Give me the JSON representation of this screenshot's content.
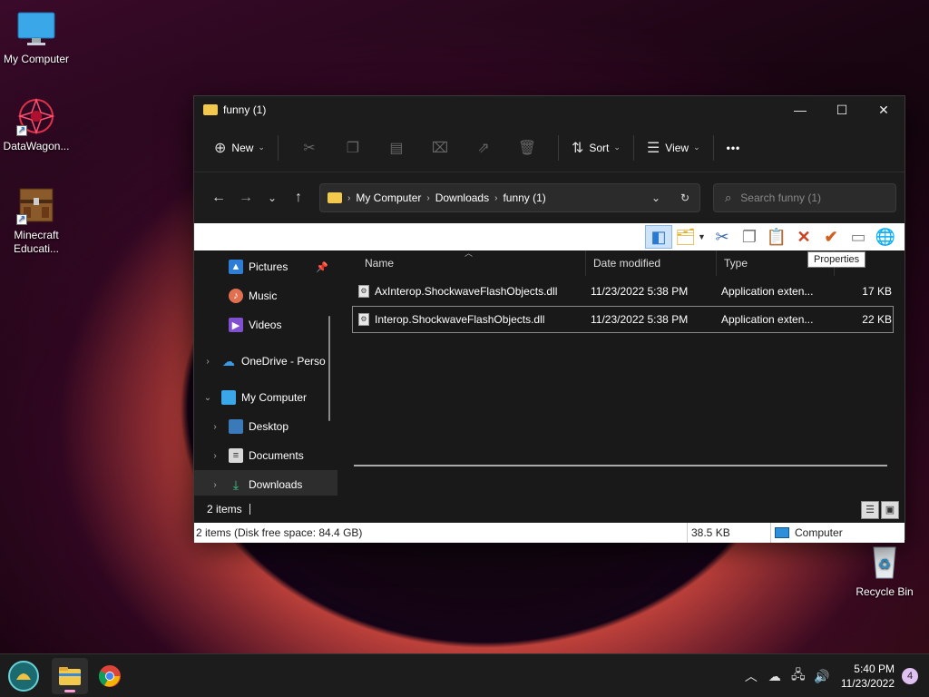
{
  "desktop": {
    "icons": [
      {
        "label": "My Computer"
      },
      {
        "label": "DataWagon..."
      },
      {
        "label": "Minecraft Educati..."
      },
      {
        "label": "Recycle Bin"
      }
    ]
  },
  "window": {
    "title": "funny (1)",
    "controls": {
      "minimize": "—",
      "maximize": "☐",
      "close": "✕"
    }
  },
  "toolbar": {
    "new_label": "New",
    "sort_label": "Sort",
    "view_label": "View",
    "more_label": "•••"
  },
  "address": {
    "crumbs": [
      "My Computer",
      "Downloads",
      "funny (1)"
    ],
    "search_placeholder": "Search funny (1)"
  },
  "legacy_toolbar": {
    "tooltip": "Properties"
  },
  "nav_pane": {
    "items": [
      {
        "label": "Pictures"
      },
      {
        "label": "Music"
      },
      {
        "label": "Videos"
      },
      {
        "label": "OneDrive - Perso"
      },
      {
        "label": "My Computer"
      },
      {
        "label": "Desktop"
      },
      {
        "label": "Documents"
      },
      {
        "label": "Downloads"
      }
    ]
  },
  "file_list": {
    "columns": {
      "name": "Name",
      "date": "Date modified",
      "type": "Type",
      "size": ""
    },
    "files": [
      {
        "name": "AxInterop.ShockwaveFlashObjects.dll",
        "date": "11/23/2022 5:38 PM",
        "type": "Application exten...",
        "size": "17 KB"
      },
      {
        "name": "Interop.ShockwaveFlashObjects.dll",
        "date": "11/23/2022 5:38 PM",
        "type": "Application exten...",
        "size": "22 KB"
      }
    ]
  },
  "status": {
    "item_count": "2 items",
    "summary": "2 items (Disk free space: 84.4 GB)",
    "size": "38.5 KB",
    "location": "Computer"
  },
  "taskbar": {
    "time": "5:40 PM",
    "date": "11/23/2022",
    "notification_count": "4"
  },
  "colors": {
    "accent": "#f2c94c",
    "window_bg": "#202020"
  }
}
